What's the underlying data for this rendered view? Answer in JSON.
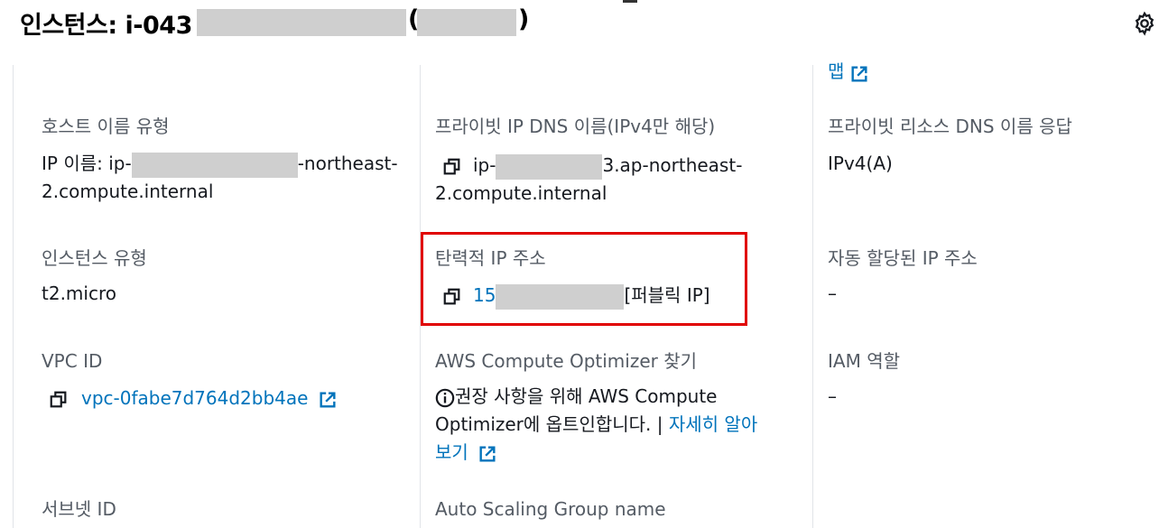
{
  "header": {
    "title_prefix": "인스턴스: i-043",
    "title_paren_open": "(",
    "title_paren_close": ")"
  },
  "col3_top": {
    "link_fragment": "맵"
  },
  "host_name_type": {
    "label": "호스트 이름 유형",
    "line1_start": "IP 이름: ip-",
    "line1_end": "-northeast-",
    "line2": "2.compute.internal"
  },
  "private_ip_dns": {
    "label": "프라이빗 IP DNS 이름(IPv4만 해당)",
    "line1_start": "ip-",
    "line1_end": "3.ap-northeast-",
    "line2": "2.compute.internal"
  },
  "private_resource_dns": {
    "label": "프라이빗 리소스 DNS 이름 응답",
    "value": "IPv4(A)"
  },
  "instance_type": {
    "label": "인스턴스 유형",
    "value": "t2.micro"
  },
  "elastic_ip": {
    "label": "탄력적 IP 주소",
    "value_start": "15",
    "value_end": "[퍼블릭 IP]"
  },
  "auto_assigned_ip": {
    "label": "자동 할당된 IP 주소",
    "value": "–"
  },
  "vpc": {
    "label": "VPC ID",
    "value": "vpc-0fabe7d764d2bb4ae"
  },
  "compute_optimizer": {
    "label": "AWS Compute Optimizer 찾기",
    "line1": "권장 사항을 위해 AWS Compute",
    "line2": "Optimizer에 옵트인합니다. | ",
    "link_part1": "자세히 알아",
    "link_part2": "보기"
  },
  "iam_role": {
    "label": "IAM 역할",
    "value": "–"
  },
  "subnet": {
    "label": "서브넷 ID"
  },
  "asg": {
    "label": "Auto Scaling Group name"
  },
  "colors": {
    "link": "#0073bb",
    "highlight": "#e00000",
    "label": "#545b64"
  },
  "icons": [
    "settings-gear-icon",
    "copy-icon",
    "external-link-icon",
    "info-icon"
  ]
}
